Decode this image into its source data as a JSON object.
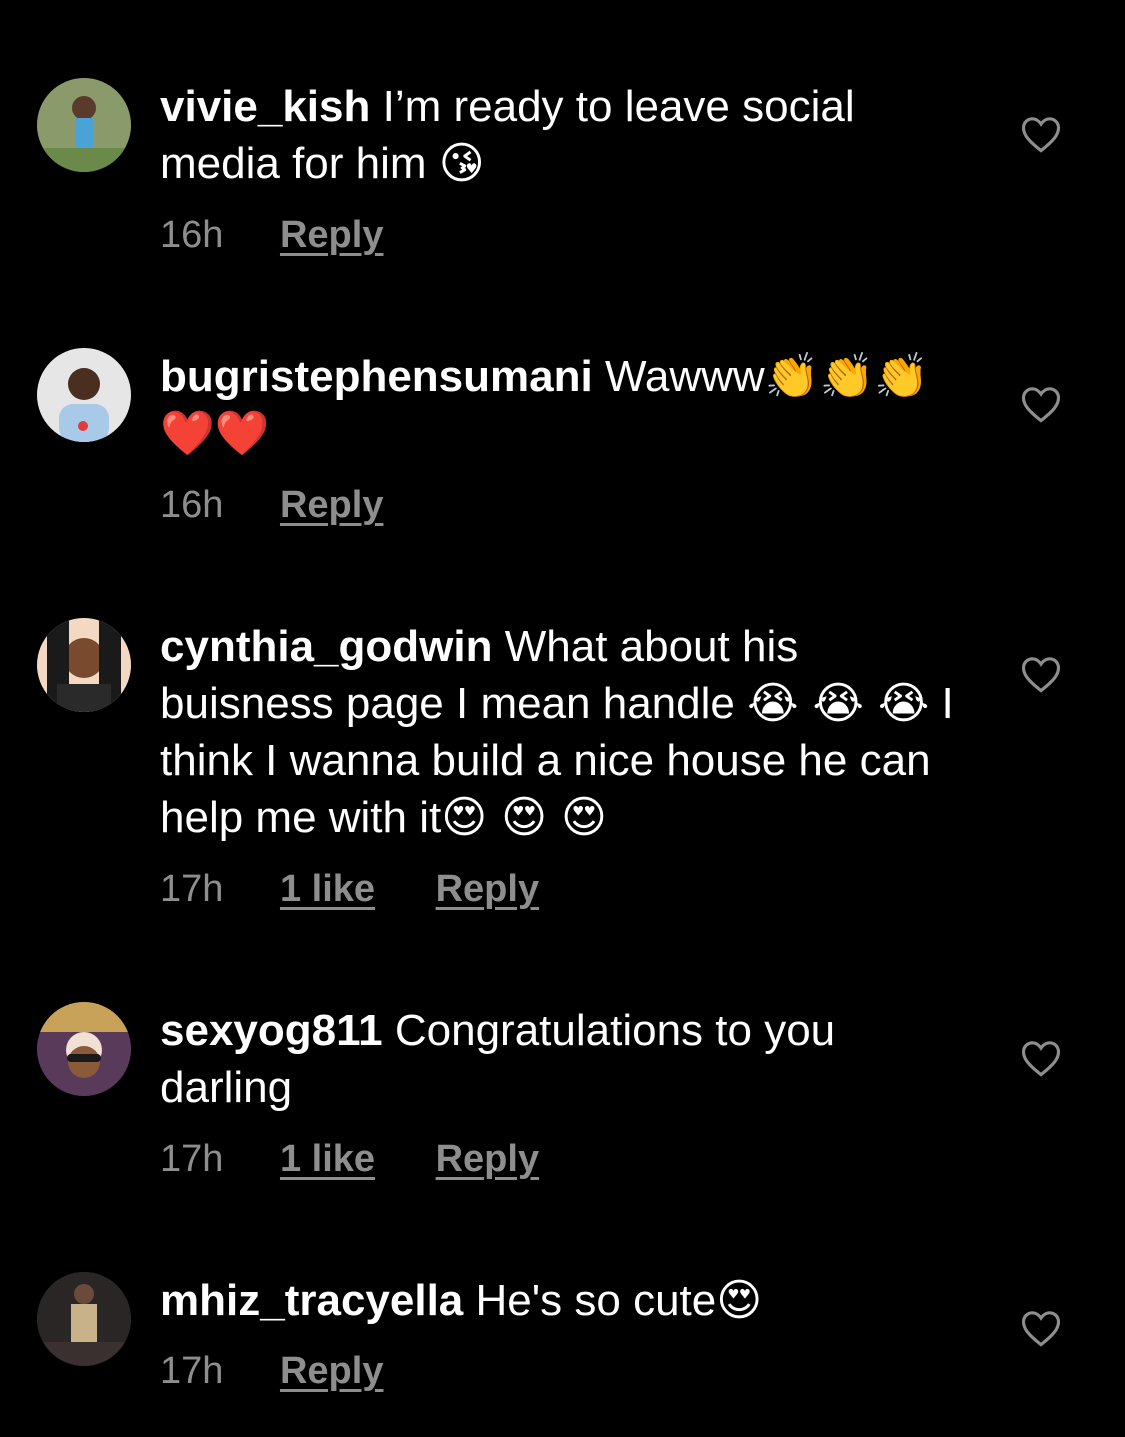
{
  "comments": [
    {
      "username": "vivie_kish",
      "text": "I’m ready to leave social media for him ",
      "emoji": "😘",
      "time": "16h",
      "likes": "",
      "reply": "Reply"
    },
    {
      "username": "bugristephensumani",
      "text": "Wawww",
      "emoji": "👏👏👏❤️❤️",
      "time": "16h",
      "likes": "",
      "reply": "Reply"
    },
    {
      "username": "cynthia_godwin",
      "text": "What about his buisness page I mean handle ",
      "emoji": "😭 😭 😭",
      "text2": "I think I wanna build a nice house he can help me with it",
      "emoji2": "😍 😍 😍",
      "time": "17h",
      "likes": "1 like",
      "reply": "Reply"
    },
    {
      "username": "sexyog811",
      "text": "Congratulations to you darling",
      "time": "17h",
      "likes": "1 like",
      "reply": "Reply"
    },
    {
      "username": "mhiz_tracyella",
      "text": "He's so cute",
      "emoji": "😍",
      "time": "17h",
      "likes": "",
      "reply": "Reply"
    }
  ],
  "icons": {
    "like": "heart-outline-icon",
    "avatar": "profile-photo"
  },
  "colors": {
    "background": "#000000",
    "text": "#ffffff",
    "secondary": "#8e8e8e"
  }
}
